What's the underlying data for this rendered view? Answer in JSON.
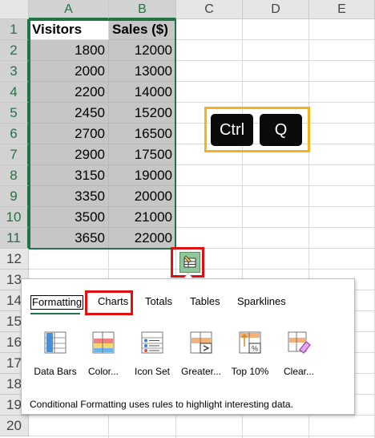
{
  "columns": [
    "A",
    "B",
    "C",
    "D",
    "E"
  ],
  "rows": [
    "1",
    "2",
    "3",
    "4",
    "5",
    "6",
    "7",
    "8",
    "9",
    "10",
    "11",
    "12",
    "13",
    "14",
    "15",
    "16",
    "17",
    "18",
    "19",
    "20"
  ],
  "table": {
    "headers": [
      "Visitors",
      "Sales ($)"
    ],
    "data": [
      [
        "1800",
        "12000"
      ],
      [
        "2000",
        "13000"
      ],
      [
        "2200",
        "14000"
      ],
      [
        "2450",
        "15200"
      ],
      [
        "2700",
        "16500"
      ],
      [
        "2900",
        "17500"
      ],
      [
        "3150",
        "19000"
      ],
      [
        "3350",
        "20000"
      ],
      [
        "3500",
        "21000"
      ],
      [
        "3650",
        "22000"
      ]
    ]
  },
  "shortcut": {
    "key1": "Ctrl",
    "key2": "Q"
  },
  "quick_analysis": {
    "tabs": [
      "Formatting",
      "Charts",
      "Totals",
      "Tables",
      "Sparklines"
    ],
    "active_tab": "Formatting",
    "highlighted_tab": "Charts",
    "options": [
      {
        "label": "Data Bars",
        "icon": "data-bars-icon"
      },
      {
        "label": "Color...",
        "icon": "color-scale-icon"
      },
      {
        "label": "Icon Set",
        "icon": "icon-set-icon"
      },
      {
        "label": "Greater...",
        "icon": "greater-than-icon"
      },
      {
        "label": "Top 10%",
        "icon": "top-10-percent-icon"
      },
      {
        "label": "Clear...",
        "icon": "clear-format-icon"
      }
    ],
    "description": "Conditional Formatting uses rules to highlight interesting data."
  },
  "colors": {
    "selection": "#217346",
    "highlight_red": "#e01010",
    "keyboard_box": "#f4b31a",
    "selected_fill": "#c6c6c6"
  }
}
